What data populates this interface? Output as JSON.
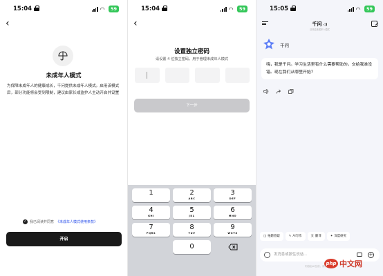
{
  "minor_mode_intro": {
    "status": {
      "time": "15:04",
      "battery": "59"
    },
    "title": "未成年人模式",
    "description": "为保障未成年人的健康成长，千问提供未成年人模式。启用该模式后，部分功能将会受到限制，建议由家长或监护人主动开启并设置",
    "agreement_prefix": "我已阅读并同意",
    "agreement_link": "《未成年人模式使用条款》",
    "button_label": "开启"
  },
  "set_password": {
    "status": {
      "time": "15:04",
      "battery": "59"
    },
    "title": "设置独立密码",
    "subtitle": "请设置 4 位独立密码，用于管理未成年人模式",
    "next_label": "下一步",
    "keys": [
      {
        "num": "1",
        "letters": ""
      },
      {
        "num": "2",
        "letters": "ABC"
      },
      {
        "num": "3",
        "letters": "DEF"
      },
      {
        "num": "4",
        "letters": "GHI"
      },
      {
        "num": "5",
        "letters": "JKL"
      },
      {
        "num": "6",
        "letters": "MNO"
      },
      {
        "num": "7",
        "letters": "PQRS"
      },
      {
        "num": "8",
        "letters": "TUV"
      },
      {
        "num": "9",
        "letters": "WXYZ"
      },
      {
        "num": "0",
        "letters": ""
      }
    ]
  },
  "chat": {
    "status": {
      "time": "15:05",
      "battery": "59"
    },
    "header_title": "千问",
    "header_sub": "已开启未成年人模式",
    "assistant_name": "千问",
    "greeting": "嗨，我是千问。学习生活里有什么需要帮助的，交给我准没错。现在我们从哪里开始?",
    "chips": [
      "拍题答疑",
      "AI写作",
      "翻译",
      "深度研究"
    ],
    "input_placeholder": "发消息或按住说话...",
    "footer": "内容由AI生成，请仔细甄别",
    "watermark": "中文网",
    "watermark_logo": "php",
    "accent": "#5b7cf6"
  }
}
